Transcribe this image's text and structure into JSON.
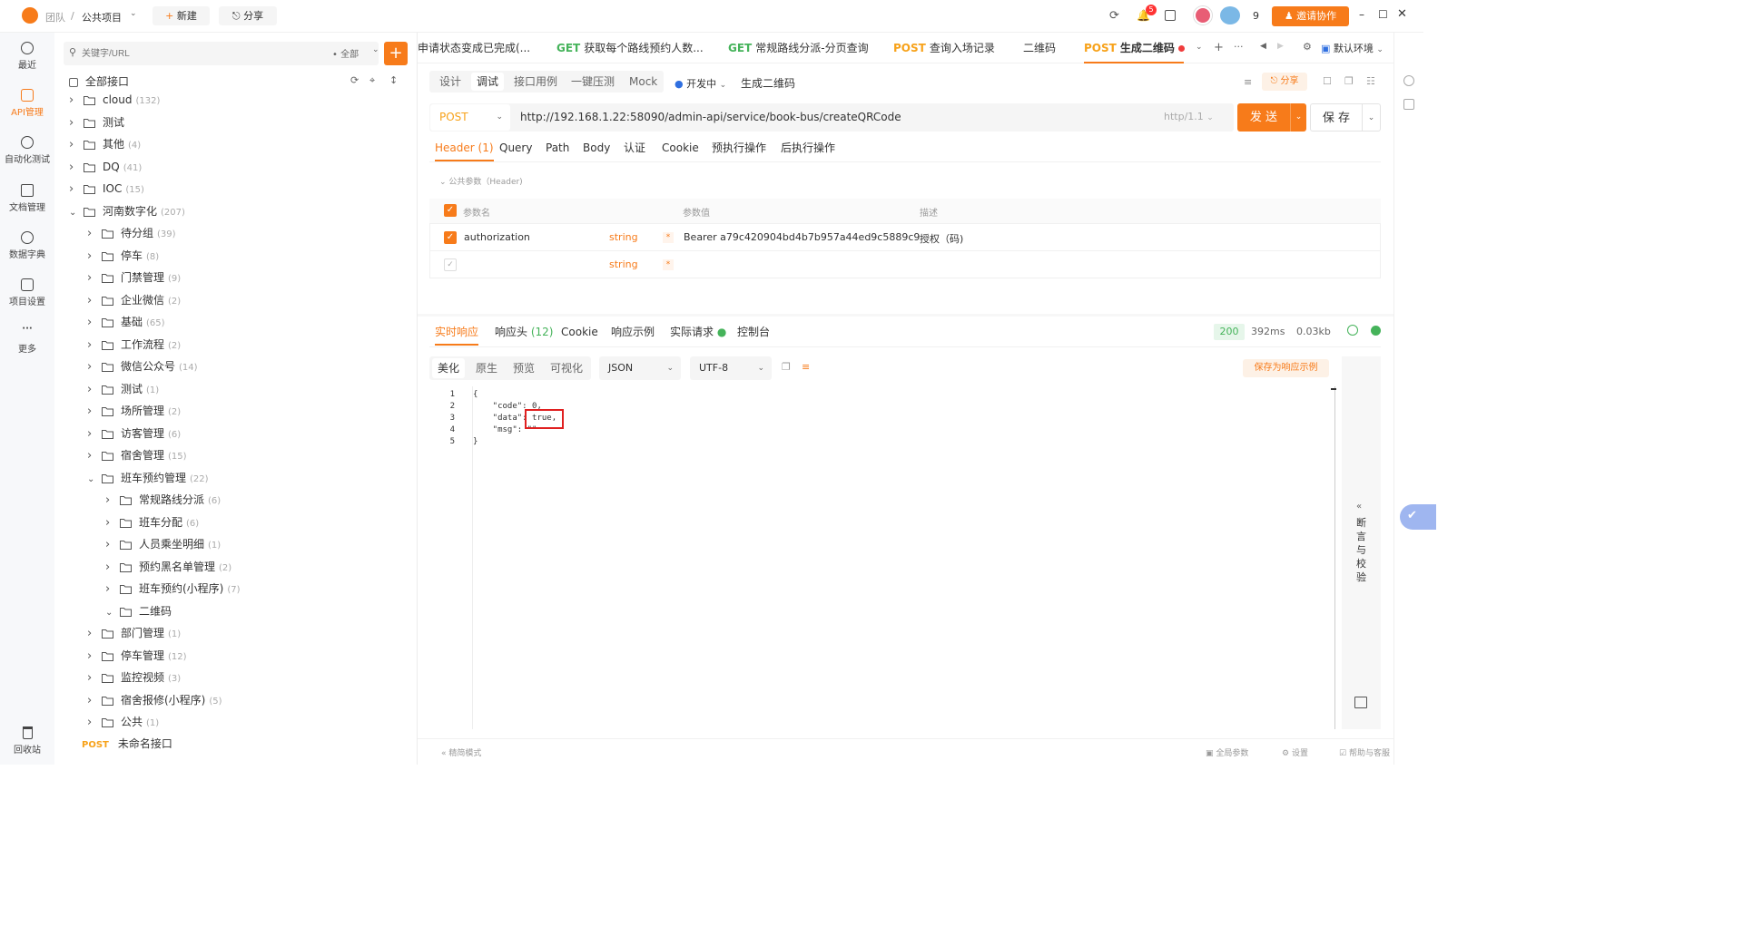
{
  "topbar": {
    "team": "团队",
    "sep": "/",
    "project": "公共项目",
    "new_label": "新建",
    "share_label": "分享",
    "notif_count": "5",
    "member_count": "9",
    "invite_label": "邀请协作"
  },
  "leftnav": {
    "items": [
      {
        "label": "最近",
        "icon": "clock-icon"
      },
      {
        "label": "API管理",
        "icon": "api-icon"
      },
      {
        "label": "自动化测试",
        "icon": "automation-icon"
      },
      {
        "label": "文档管理",
        "icon": "doc-icon"
      },
      {
        "label": "数据字典",
        "icon": "dictionary-icon"
      },
      {
        "label": "项目设置",
        "icon": "settings-icon"
      },
      {
        "label": "更多",
        "icon": "more-icon"
      }
    ],
    "recycle": "回收站"
  },
  "tree": {
    "search_placeholder": "关键字/URL",
    "filter": "全部",
    "all_label": "全部接口",
    "items": [
      {
        "name": "cloud",
        "count": "(132)",
        "level": 0,
        "open": false
      },
      {
        "name": "测试",
        "count": "",
        "level": 0,
        "open": false
      },
      {
        "name": "其他",
        "count": "(4)",
        "level": 0,
        "open": false
      },
      {
        "name": "DQ",
        "count": "(41)",
        "level": 0,
        "open": false
      },
      {
        "name": "IOC",
        "count": "(15)",
        "level": 0,
        "open": false
      },
      {
        "name": "河南数字化",
        "count": "(207)",
        "level": 0,
        "open": true
      },
      {
        "name": "待分组",
        "count": "(39)",
        "level": 1,
        "open": false
      },
      {
        "name": "停车",
        "count": "(8)",
        "level": 1,
        "open": false
      },
      {
        "name": "门禁管理",
        "count": "(9)",
        "level": 1,
        "open": false
      },
      {
        "name": "企业微信",
        "count": "(2)",
        "level": 1,
        "open": false
      },
      {
        "name": "基础",
        "count": "(65)",
        "level": 1,
        "open": false
      },
      {
        "name": "工作流程",
        "count": "(2)",
        "level": 1,
        "open": false
      },
      {
        "name": "微信公众号",
        "count": "(14)",
        "level": 1,
        "open": false
      },
      {
        "name": "测试",
        "count": "(1)",
        "level": 1,
        "open": false
      },
      {
        "name": "场所管理",
        "count": "(2)",
        "level": 1,
        "open": false
      },
      {
        "name": "访客管理",
        "count": "(6)",
        "level": 1,
        "open": false
      },
      {
        "name": "宿舍管理",
        "count": "(15)",
        "level": 1,
        "open": false
      },
      {
        "name": "班车预约管理",
        "count": "(22)",
        "level": 1,
        "open": true
      },
      {
        "name": "常规路线分派",
        "count": "(6)",
        "level": 2,
        "open": false
      },
      {
        "name": "班车分配",
        "count": "(6)",
        "level": 2,
        "open": false
      },
      {
        "name": "人员乘坐明细",
        "count": "(1)",
        "level": 2,
        "open": false
      },
      {
        "name": "预约黑名单管理",
        "count": "(2)",
        "level": 2,
        "open": false
      },
      {
        "name": "班车预约(小程序)",
        "count": "(7)",
        "level": 2,
        "open": false
      },
      {
        "name": "二维码",
        "count": "",
        "level": 2,
        "open": true
      },
      {
        "name": "部门管理",
        "count": "(1)",
        "level": 1,
        "open": false
      },
      {
        "name": "停车管理",
        "count": "(12)",
        "level": 1,
        "open": false
      },
      {
        "name": "监控视频",
        "count": "(3)",
        "level": 1,
        "open": false
      },
      {
        "name": "宿舍报修(小程序)",
        "count": "(5)",
        "level": 1,
        "open": false
      },
      {
        "name": "公共",
        "count": "(1)",
        "level": 1,
        "open": false
      }
    ],
    "unnamed_method": "POST",
    "unnamed_label": "未命名接口"
  },
  "tabs": [
    {
      "method": "",
      "label": "申请状态变成已完成(..."
    },
    {
      "method": "GET",
      "label": "获取每个路线预约人数..."
    },
    {
      "method": "GET",
      "label": "常规路线分派-分页查询"
    },
    {
      "method": "POST",
      "label": "查询入场记录"
    },
    {
      "method": "",
      "label": "二维码"
    },
    {
      "method": "POST",
      "label": "生成二维码"
    }
  ],
  "env_label": "默认环境",
  "modes": [
    "设计",
    "调试",
    "接口用例",
    "一键压测",
    "Mock"
  ],
  "status_label": "开发中",
  "api_name": "生成二维码",
  "share_label": "分享",
  "request": {
    "method": "POST",
    "url": "http://192.168.1.22:58090/admin-api/service/book-bus/createQRCode",
    "protocol": "http/1.1",
    "send": "发 送",
    "save": "保 存"
  },
  "req_tabs": [
    "Header (1)",
    "Query",
    "Path",
    "Body",
    "认证",
    "Cookie",
    "预执行操作",
    "后执行操作"
  ],
  "public_params": "公共参数（Header)",
  "header_table": {
    "cols": [
      "参数名",
      "参数值",
      "描述"
    ],
    "rows": [
      {
        "name": "authorization",
        "type": "string",
        "value": "Bearer a79c420904bd4b7b957a44ed9c5889c9",
        "desc": "授权（码)"
      },
      {
        "name": "",
        "type": "string",
        "value": "",
        "desc": ""
      }
    ]
  },
  "resp_tabs": [
    "实时响应",
    "响应头 (12)",
    "Cookie",
    "响应示例",
    "实际请求",
    "控制台"
  ],
  "resp_meta": {
    "status": "200",
    "time": "392ms",
    "size": "0.03kb"
  },
  "view_modes": [
    "美化",
    "原生",
    "预览",
    "可视化"
  ],
  "format": "JSON",
  "encoding": "UTF-8",
  "save_example": "保存为响应示例",
  "code_lines": [
    "{",
    "    \"code\": 0,",
    "    \"data\": true,",
    "    \"msg\": \"\"",
    "}"
  ],
  "assert_panel": "断言与校验",
  "bottom": {
    "simple_mode": "精简模式",
    "global_params": "全局参数",
    "settings": "设置",
    "help": "帮助与客服"
  },
  "colors": {
    "accent": "#f77b1a",
    "post": "#f7a21a",
    "get": "#45b35a",
    "highlight": "#e02020"
  }
}
